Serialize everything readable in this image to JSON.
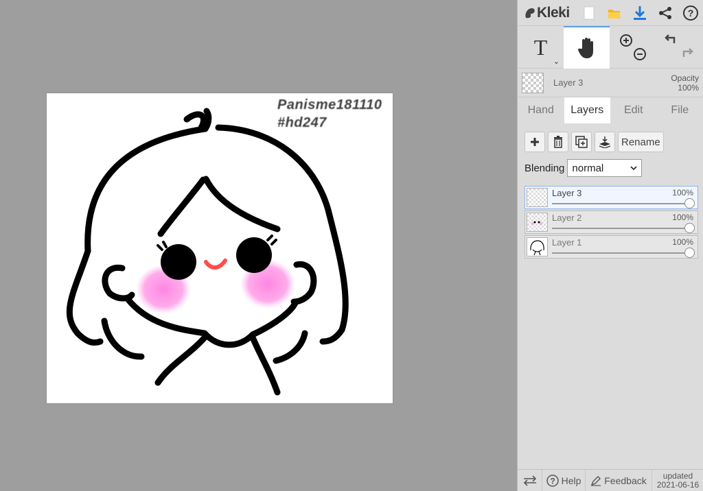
{
  "app": {
    "name": "Kleki"
  },
  "canvas": {
    "watermark_line1": "Panisme181110",
    "watermark_line2": "#hd247"
  },
  "toolbar": {
    "icons": [
      "new-file-icon",
      "open-folder-icon",
      "download-icon",
      "share-icon",
      "help-icon"
    ]
  },
  "tools": {
    "text_label": "T",
    "active": "hand"
  },
  "current_layer": {
    "name": "Layer 3",
    "opacity_label": "Opacity",
    "opacity_value": "100%"
  },
  "tabs": [
    {
      "label": "Hand",
      "active": false
    },
    {
      "label": "Layers",
      "active": true
    },
    {
      "label": "Edit",
      "active": false
    },
    {
      "label": "File",
      "active": false
    }
  ],
  "layer_actions": {
    "rename_label": "Rename"
  },
  "blending": {
    "label": "Blending",
    "value": "normal"
  },
  "layers": [
    {
      "name": "Layer 3",
      "opacity": "100%",
      "opacity_fraction": 1.0,
      "active": true
    },
    {
      "name": "Layer 2",
      "opacity": "100%",
      "opacity_fraction": 1.0,
      "active": false
    },
    {
      "name": "Layer 1",
      "opacity": "100%",
      "opacity_fraction": 1.0,
      "active": false
    }
  ],
  "bottom": {
    "help_label": "Help",
    "feedback_label": "Feedback",
    "updated_label": "updated",
    "updated_date": "2021-06-16"
  },
  "colors": {
    "accent": "#5aa0e8",
    "blush": "#ff7fe0",
    "panel_bg": "#dcdcdc",
    "workspace_bg": "#9e9e9e"
  }
}
